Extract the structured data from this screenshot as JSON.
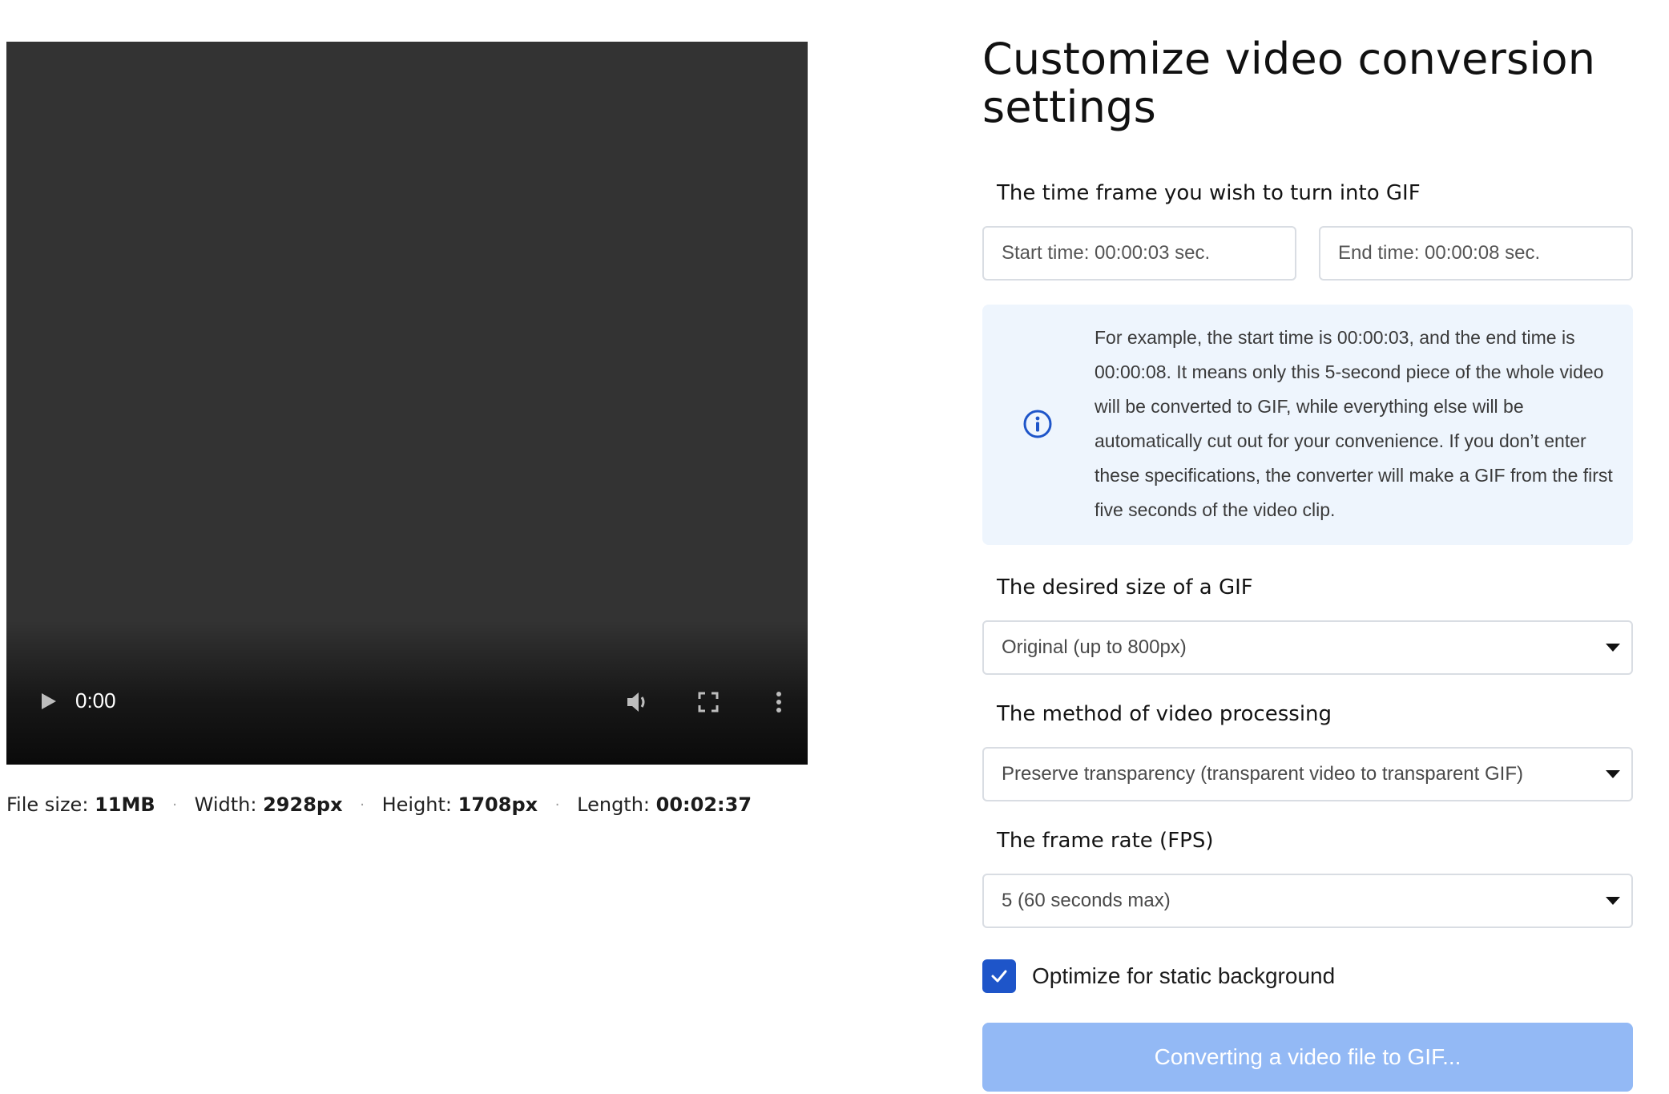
{
  "player": {
    "current_time": "0:00",
    "play_icon": "play-icon",
    "volume_icon": "volume-icon",
    "fullscreen_icon": "fullscreen-icon",
    "more_icon": "more-vertical-icon",
    "progress": 0
  },
  "file_info": {
    "size_label": "File size:",
    "size_value": "11MB",
    "width_label": "Width:",
    "width_value": "2928px",
    "height_label": "Height:",
    "height_value": "1708px",
    "length_label": "Length:",
    "length_value": "00:02:37",
    "separator": "·"
  },
  "settings": {
    "title": "Customize video conversion settings",
    "time_frame": {
      "label": "The time frame you wish to turn into GIF",
      "start_placeholder": "Start time: 00:00:03 sec.",
      "end_placeholder": "End time: 00:00:08 sec."
    },
    "info": {
      "icon": "info-icon",
      "text": "For example, the start time is 00:00:03, and the end time is 00:00:08. It means only this 5-second piece of the whole video will be converted to GIF, while everything else will be automatically cut out for your convenience. If you don’t enter these specifications, the converter will make a GIF from the first five seconds of the video clip."
    },
    "size": {
      "label": "The desired size of a GIF",
      "selected": "Original (up to 800px)"
    },
    "method": {
      "label": "The method of video processing",
      "selected": "Preserve transparency (transparent video to transparent GIF)"
    },
    "fps": {
      "label": "The frame rate (FPS)",
      "selected": "5 (60 seconds max)"
    },
    "optimize": {
      "label": "Optimize for static background",
      "checked": true
    },
    "convert_button": {
      "label": "Converting a video file to GIF..."
    }
  },
  "colors": {
    "player_bg": "#333333",
    "accent": "#1e55c9",
    "button_disabled": "#93b9f5",
    "info_bg": "#eef5fd"
  }
}
